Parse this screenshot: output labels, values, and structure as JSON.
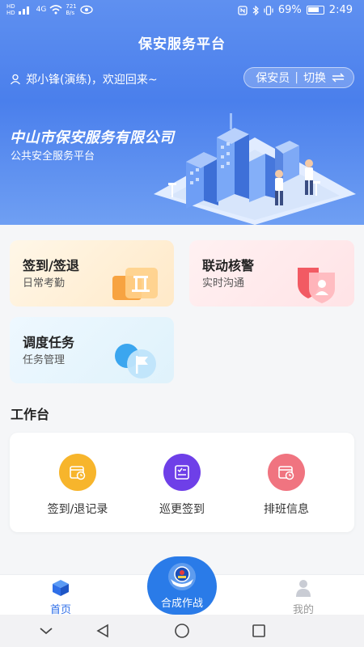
{
  "status_bar": {
    "network_left": "HD",
    "signal_label": "4G",
    "speed_value": "721",
    "speed_unit": "B/s",
    "battery": "69%",
    "time": "2:49"
  },
  "header": {
    "title": "保安服务平台",
    "greeting": "郑小锋(演练)，欢迎回来~",
    "role": "保安员",
    "switch_label": "切换"
  },
  "banner": {
    "company": "中山市保安服务有限公司",
    "subtitle": "公共安全服务平台"
  },
  "cards": [
    {
      "title": "签到/签退",
      "subtitle": "日常考勤"
    },
    {
      "title": "联动核警",
      "subtitle": "实时沟通"
    },
    {
      "title": "调度任务",
      "subtitle": "任务管理"
    }
  ],
  "workbench": {
    "title": "工作台",
    "items": [
      {
        "label": "签到/退记录",
        "color": "#f7b52c",
        "icon": "clock-calendar-icon"
      },
      {
        "label": "巡更签到",
        "color": "#6e3fe8",
        "icon": "checklist-icon"
      },
      {
        "label": "排班信息",
        "color": "#f07480",
        "icon": "schedule-icon"
      }
    ]
  },
  "tabbar": {
    "home": "首页",
    "combat": "合成作战",
    "mine": "我的"
  },
  "colors": {
    "primary": "#2f6fe8",
    "hero": "#4a7fec"
  }
}
